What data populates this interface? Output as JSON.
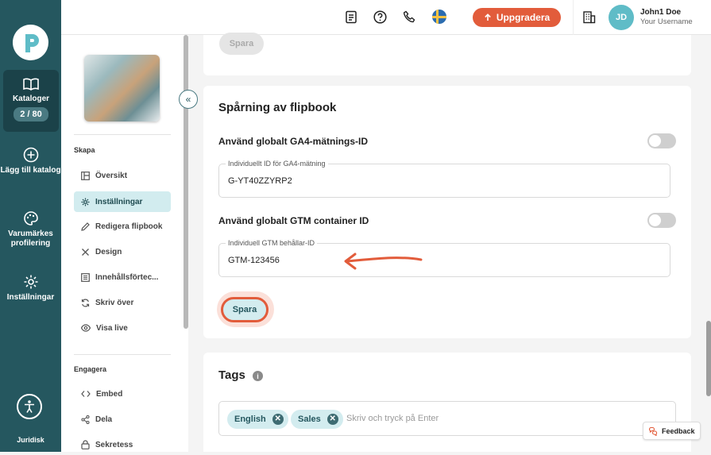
{
  "rail": {
    "items": [
      {
        "label": "Kataloger",
        "counter": "2 / 80"
      },
      {
        "label": "Lägg till katalog"
      },
      {
        "label": "Varumärkes profilering"
      },
      {
        "label": "Inställningar"
      }
    ],
    "footer": "Juridisk"
  },
  "topbar": {
    "upgrade_label": "Uppgradera",
    "avatar_initials": "JD",
    "user_name": "John1 Doe",
    "user_sub": "Your Username"
  },
  "nav": {
    "section_create": "Skapa",
    "create_items": [
      "Översikt",
      "Inställningar",
      "Redigera flipbook",
      "Design",
      "Innehållsförtec...",
      "Skriv över",
      "Visa live"
    ],
    "section_engage": "Engagera",
    "engage_items": [
      "Embed",
      "Dela",
      "Sekretess"
    ]
  },
  "tracking": {
    "top_save_label": "Spara",
    "title": "Spårning av flipbook",
    "ga4_label": "Använd globalt GA4-mätnings-ID",
    "ga4_field_label": "Individuellt ID för GA4-mätning",
    "ga4_value": "G-YT40ZZYRP2",
    "gtm_label": "Använd globalt GTM container ID",
    "gtm_field_label": "Individuell GTM behållar-ID",
    "gtm_value": "GTM-123456",
    "save_label": "Spara"
  },
  "tags": {
    "title": "Tags",
    "items": [
      "English",
      "Sales"
    ],
    "placeholder": "Skriv och tryck på Enter"
  },
  "feedback_label": "Feedback",
  "colors": {
    "rail": "#25575f",
    "accent": "#e25c3b",
    "teal_light": "#d3ecef"
  }
}
